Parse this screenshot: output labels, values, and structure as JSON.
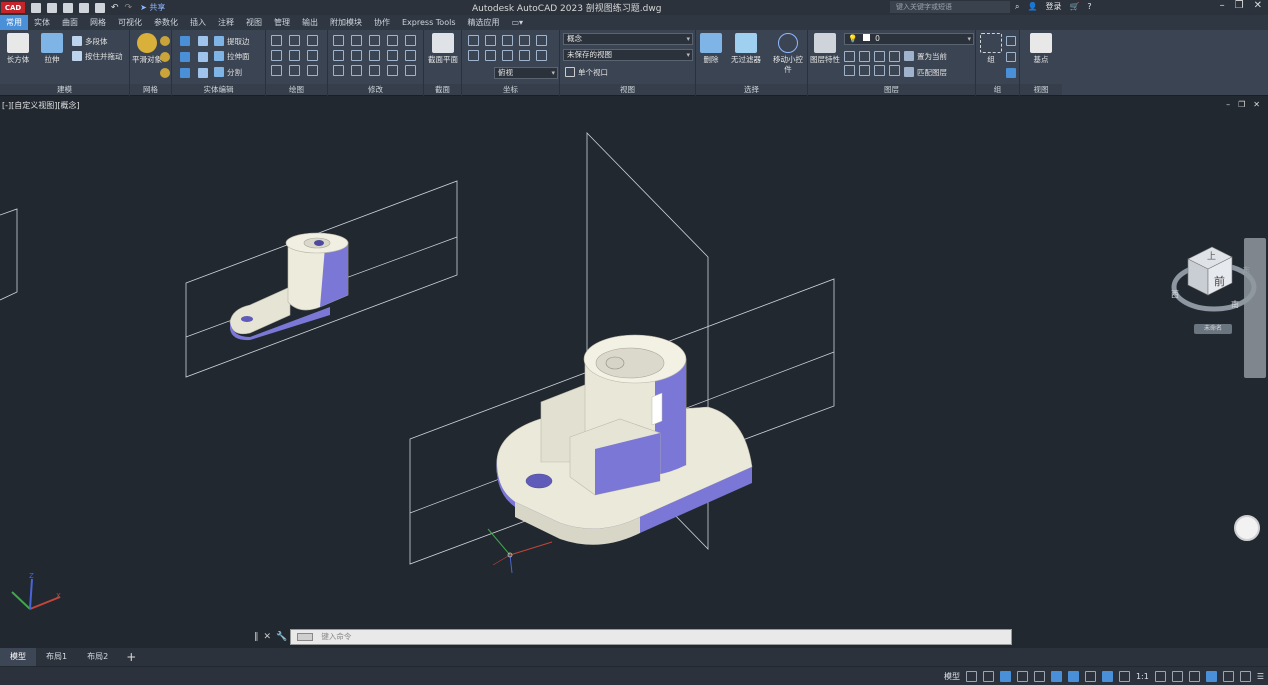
{
  "app": {
    "logo": "CAD",
    "title": "Autodesk AutoCAD 2023    剖视图练习题.dwg",
    "share_label": "共享",
    "search_placeholder": "键入关键字或短语",
    "login_label": "登录"
  },
  "tabs": [
    "常用",
    "实体",
    "曲面",
    "网格",
    "可视化",
    "参数化",
    "插入",
    "注释",
    "视图",
    "管理",
    "输出",
    "附加模块",
    "协作",
    "Express Tools",
    "精选应用"
  ],
  "active_tab": "常用",
  "ribbon": {
    "modeling": {
      "title": "建模",
      "box_label": "长方体",
      "extrude_label": "拉伸",
      "polysolid_label": "多段体",
      "presspull_label": "按住并拖动"
    },
    "mesh": {
      "title": "网格",
      "smooth_label": "平滑对象"
    },
    "solid_edit": {
      "title": "实体编辑",
      "extract_label": "提取边",
      "extrude_face_label": "拉伸面",
      "separate_label": "分割"
    },
    "draw": {
      "title": "绘图"
    },
    "modify": {
      "title": "修改"
    },
    "section": {
      "title": "截面",
      "plane_label": "截面平面"
    },
    "coordinates": {
      "title": "坐标",
      "ucs_value": "俯视"
    },
    "view": {
      "title": "视图",
      "visual_style": "概念",
      "saved_view": "未保存的视图",
      "viewport": "单个视口"
    },
    "selection": {
      "title": "选择",
      "culling_label": "删除",
      "nofilter_label": "无过滤器",
      "gizmo_label": "移动小控件"
    },
    "layers": {
      "title": "图层",
      "props_label": "图层特性",
      "current_layer": "0",
      "set_current_label": "置为当前",
      "match_label": "匹配图层"
    },
    "groups": {
      "title": "组",
      "group_label": "组"
    },
    "view2": {
      "title": "视图",
      "base_label": "基点"
    }
  },
  "viewport": {
    "label": "[-][自定义视图][概念]",
    "viewcube": {
      "top": "上",
      "front": "前",
      "west": "西",
      "south": "南",
      "east": "东",
      "wcs": "未命名"
    }
  },
  "command": {
    "placeholder": "键入命令"
  },
  "layout_tabs": [
    "模型",
    "布局1",
    "布局2"
  ],
  "active_layout": "模型",
  "status": {
    "model_label": "模型",
    "scale": "1:1"
  },
  "colors": {
    "accent": "#4a90d9",
    "face_light": "#e8e6d6",
    "face_dark": "#7a76d8",
    "background": "#212830"
  }
}
